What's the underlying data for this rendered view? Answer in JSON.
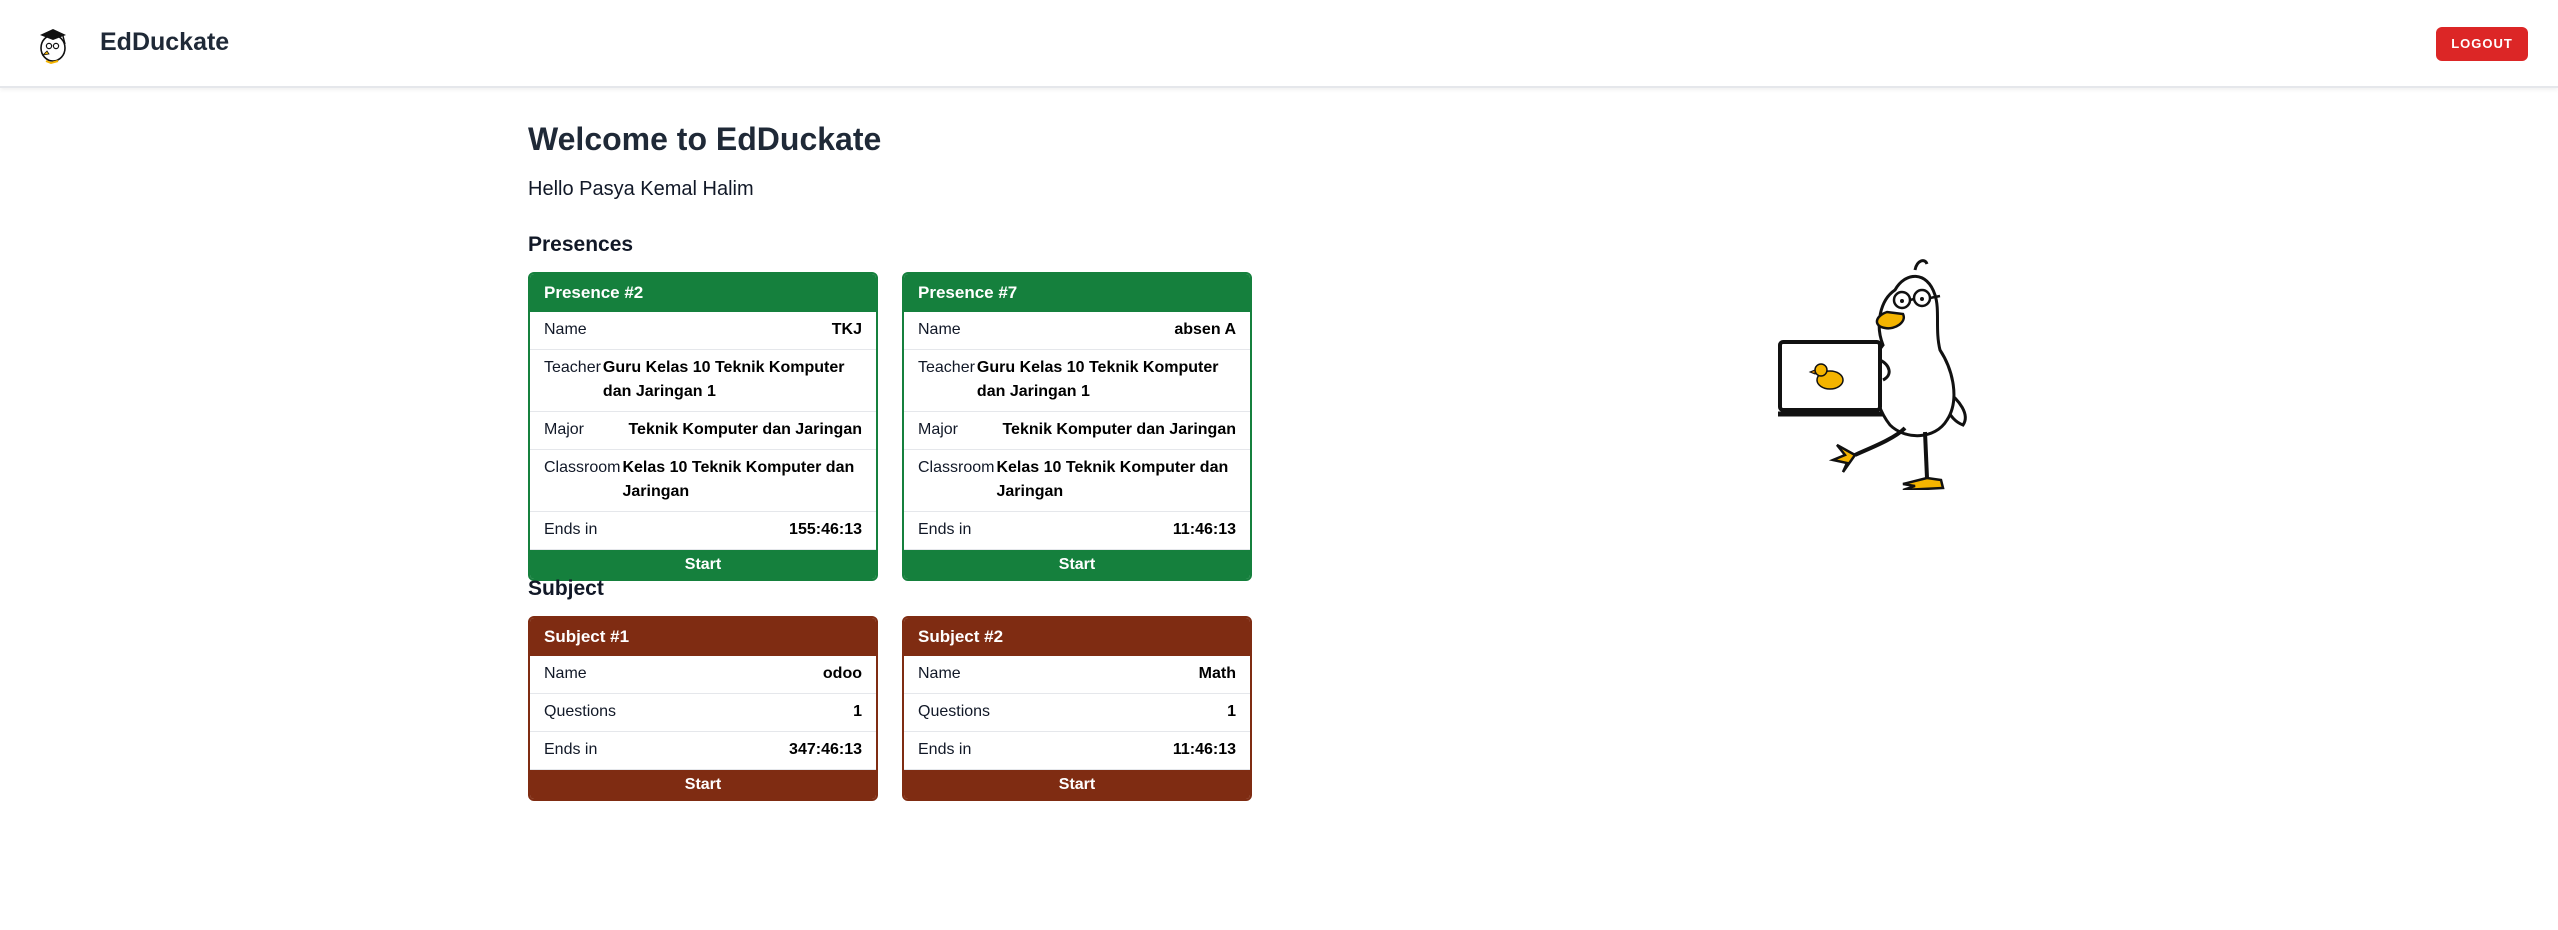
{
  "header": {
    "brand": "EdDuckate",
    "logout_label": "LOGOUT",
    "icons": {
      "logo": "duck-logo-icon"
    }
  },
  "main": {
    "title": "Welcome to EdDuckate",
    "greeting": "Hello Pasya Kemal Halim",
    "presences_title": "Presences",
    "subject_title": "Subject",
    "presences": [
      {
        "title": "Presence #2",
        "name_label": "Name",
        "name": "TKJ",
        "teacher_label": "Teacher",
        "teacher": "Guru Kelas 10 Teknik Komputer dan Jaringan 1",
        "major_label": "Major",
        "major": "Teknik Komputer dan Jaringan",
        "classroom_label": "Classroom",
        "classroom": "Kelas 10 Teknik Komputer dan Jaringan",
        "ends_label": "Ends in",
        "ends": "155:46:13",
        "button": "Start"
      },
      {
        "title": "Presence #7",
        "name_label": "Name",
        "name": "absen A",
        "teacher_label": "Teacher",
        "teacher": "Guru Kelas 10 Teknik Komputer dan Jaringan 1",
        "major_label": "Major",
        "major": "Teknik Komputer dan Jaringan",
        "classroom_label": "Classroom",
        "classroom": "Kelas 10 Teknik Komputer dan Jaringan",
        "ends_label": "Ends in",
        "ends": "11:46:13",
        "button": "Start"
      }
    ],
    "subjects": [
      {
        "title": "Subject #1",
        "name_label": "Name",
        "name": "odoo",
        "questions_label": "Questions",
        "questions": "1",
        "ends_label": "Ends in",
        "ends": "347:46:13",
        "button": "Start"
      },
      {
        "title": "Subject #2",
        "name_label": "Name",
        "name": "Math",
        "questions_label": "Questions",
        "questions": "1",
        "ends_label": "Ends in",
        "ends": "11:46:13",
        "button": "Start"
      }
    ]
  },
  "colors": {
    "presence": "#15803d",
    "subject": "#7f2c12",
    "logout": "#dc2626",
    "duck_accent": "#f4b400"
  },
  "illustration": {
    "icon": "duck-with-laptop-illustration"
  }
}
